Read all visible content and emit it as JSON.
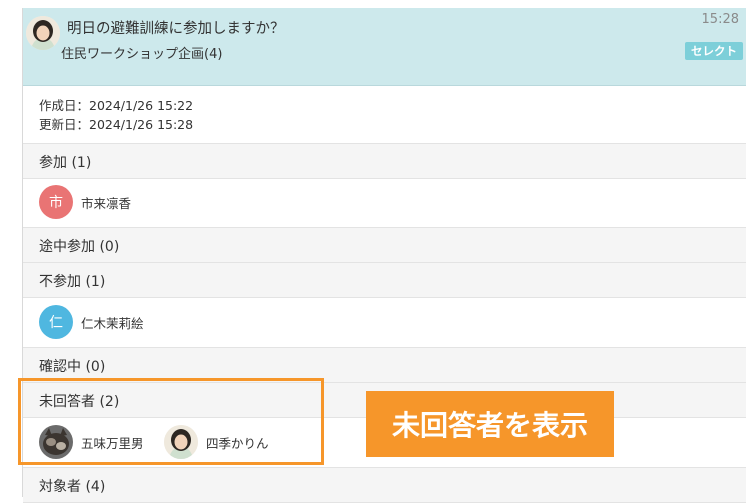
{
  "header": {
    "title": "明日の避難訓練に参加しますか？",
    "group": "住民ワークショップ企画(4)",
    "time": "15:28",
    "select_label": "セレクト"
  },
  "dates": {
    "created": "作成日：2024/1/26 15:22",
    "updated": "更新日：2024/1/26 15:28"
  },
  "sections": {
    "attend": {
      "label": "参加 (1)",
      "members": [
        {
          "initial": "市",
          "name": "市来凛香",
          "color": "#e97474"
        }
      ]
    },
    "partial": {
      "label": "途中参加 (0)"
    },
    "absent": {
      "label": "不参加 (1)",
      "members": [
        {
          "initial": "仁",
          "name": "仁木茉莉絵",
          "color": "#4fb7e0"
        }
      ]
    },
    "pending": {
      "label": "確認中 (0)"
    },
    "unanswered": {
      "label": "未回答者 (2)",
      "members": [
        {
          "name": "五味万里男"
        },
        {
          "name": "四季かりん"
        }
      ]
    },
    "targets": {
      "label": "対象者 (4)"
    }
  },
  "callout": "未回答者を表示",
  "colors": {
    "header_bg": "#cde9ec",
    "accent": "#f6962a",
    "select_btn": "#7dcfd9"
  }
}
